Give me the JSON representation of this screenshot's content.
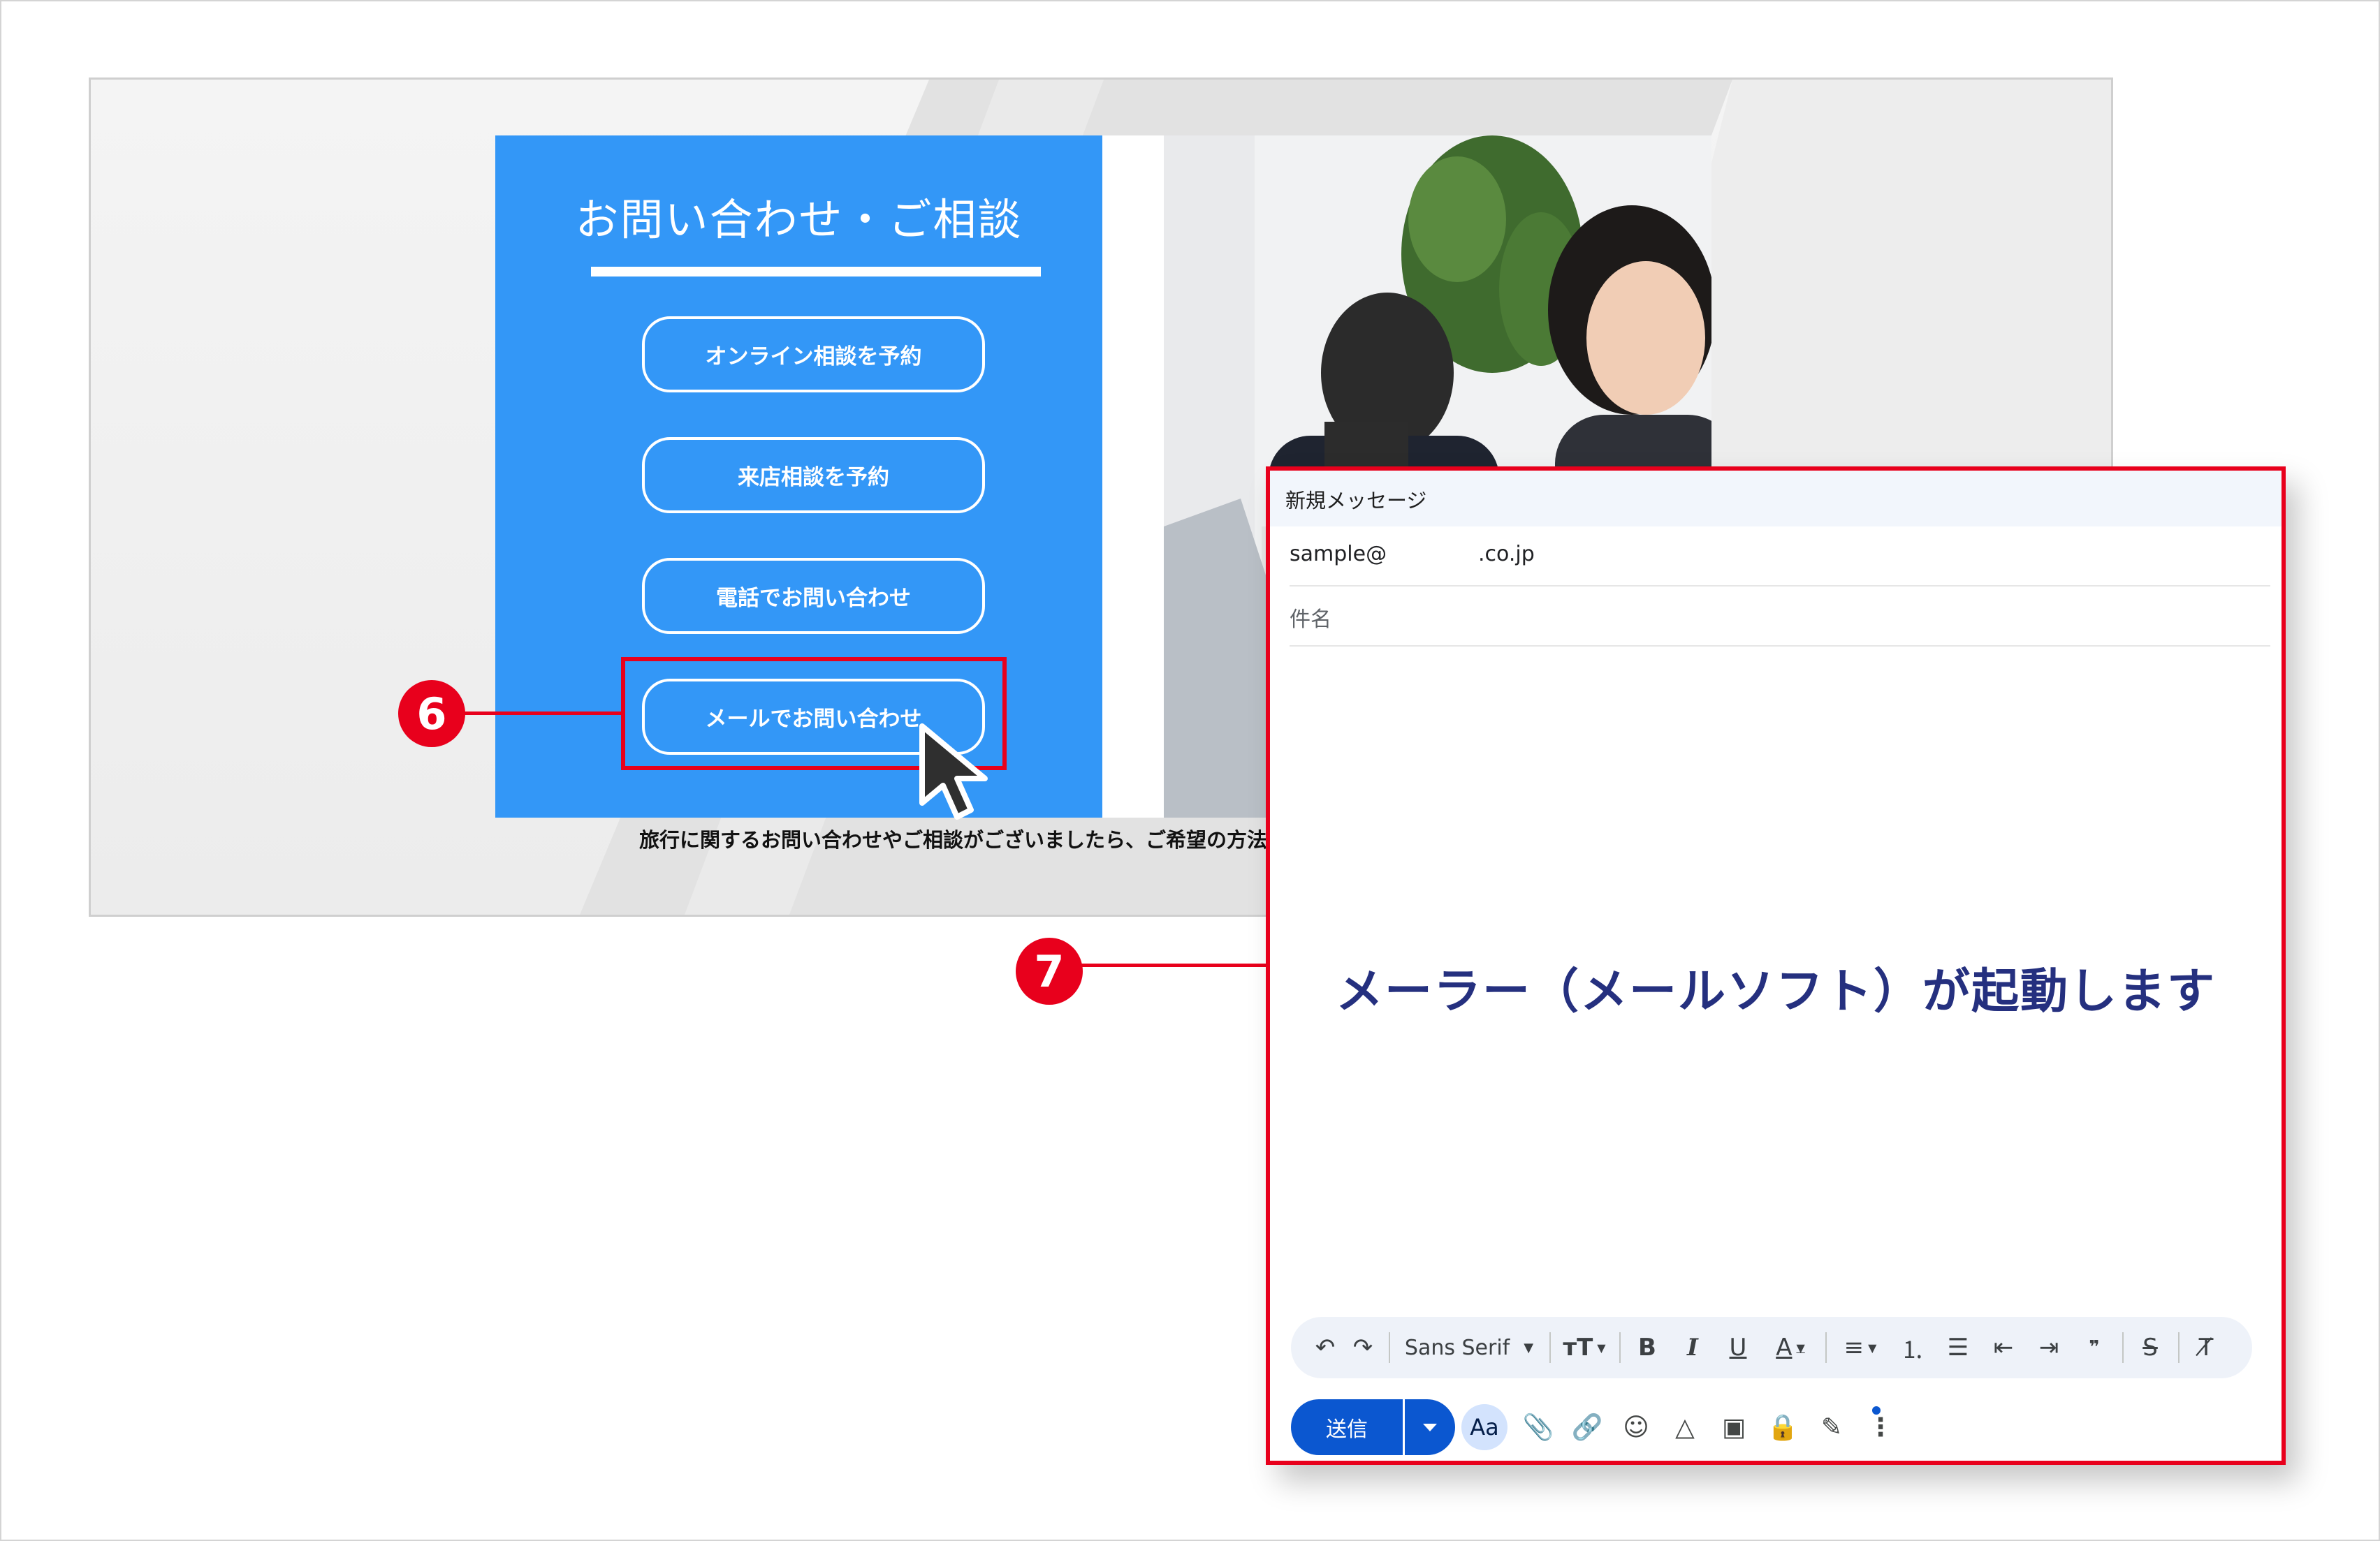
{
  "website": {
    "panel_title": "お問い合わせ・ご相談",
    "buttons": [
      {
        "label": "オンライン相談を予約"
      },
      {
        "label": "来店相談を予約"
      },
      {
        "label": "電話でお問い合わせ"
      },
      {
        "label": "メールでお問い合わせ"
      }
    ],
    "caption": "旅行に関するお問い合わせやご相談がございましたら、ご希望の方法",
    "panel_color": "#3397f7"
  },
  "steps": {
    "step6": "6",
    "step7": "7",
    "highlight_color": "#e8001c"
  },
  "compose": {
    "title": "新規メッセージ",
    "to_left": "sample@",
    "to_right": ".co.jp",
    "subject_placeholder": "件名",
    "body_message": "メーラー（メールソフト）が起動します",
    "format_bar": {
      "font_name": "Sans Serif",
      "icons": [
        "undo-icon",
        "redo-icon",
        "font-select",
        "text-size-icon",
        "bold-icon",
        "italic-icon",
        "underline-icon",
        "text-color-icon",
        "align-icon",
        "numbered-list-icon",
        "bulleted-list-icon",
        "indent-less-icon",
        "indent-more-icon",
        "quote-icon",
        "strikethrough-icon",
        "clear-format-icon"
      ]
    },
    "send_label": "送信",
    "formatting_label": "Aa",
    "accent_color": "#0b57d0"
  }
}
